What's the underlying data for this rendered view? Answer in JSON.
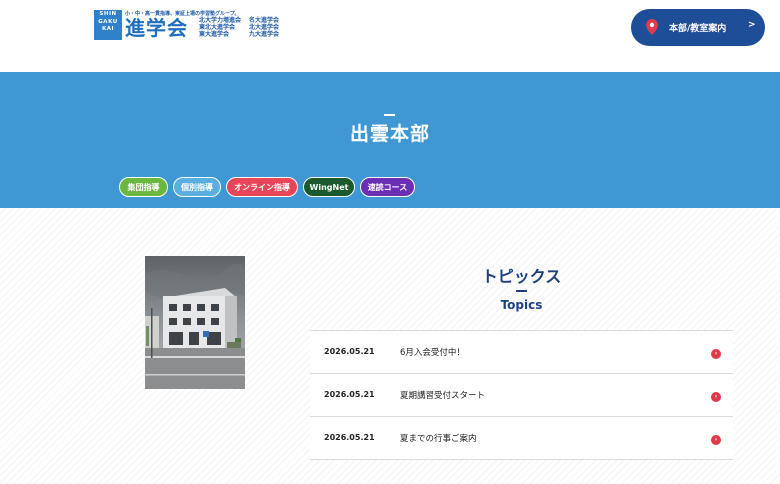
{
  "header": {
    "logo": {
      "badge_lines": [
        "SHIN",
        "GAKU",
        "KAI"
      ],
      "tagline": "小・中・高一貫指導、東証上場の学習塾グループ。",
      "name": "進学会",
      "schools": [
        "北大学力増進会",
        "北大進学会",
        "東北大進学会",
        "名大進学会",
        "東大進学会",
        "九大進学会"
      ]
    },
    "hq_button": {
      "label": "本部/教室案内",
      "arrow": ">"
    }
  },
  "hero": {
    "title": "出雲本部",
    "tags": [
      {
        "label": "集団指導",
        "color": "#6cb73f"
      },
      {
        "label": "個別指導",
        "color": "#5aaee0"
      },
      {
        "label": "オンライン指導",
        "color": "#e8455a"
      },
      {
        "label": "WingNet",
        "color": "#1a5a2c"
      },
      {
        "label": "速読コース",
        "color": "#6a2fb5"
      }
    ]
  },
  "topics": {
    "title": "トピックス",
    "subtitle": "Topics",
    "items": [
      {
        "date": "2026.05.21",
        "text": "6月入会受付中！"
      },
      {
        "date": "2026.05.21",
        "text": "夏期講習受付スタート"
      },
      {
        "date": "2026.05.21",
        "text": "夏までの行事ご案内"
      }
    ]
  },
  "colors": {
    "brand_blue": "#1f4e99",
    "hero_blue": "#3f97d4",
    "accent_red": "#e03a4a"
  }
}
